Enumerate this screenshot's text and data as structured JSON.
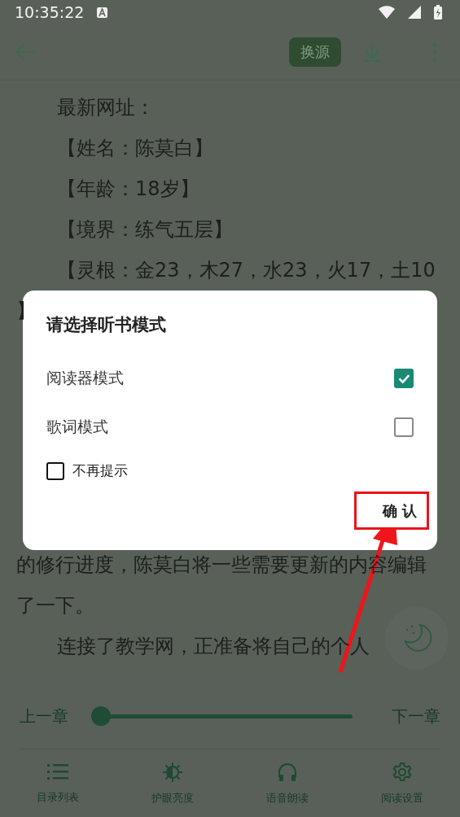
{
  "status_bar": {
    "time": "10:35:22"
  },
  "toolbar": {
    "source_button": "换源"
  },
  "content": {
    "top_lines": [
      {
        "text": "最新网址：",
        "indent": true
      },
      {
        "text": "【姓名：陈莫白】",
        "indent": true
      },
      {
        "text": "【年龄：18岁】",
        "indent": true
      },
      {
        "text": "【境界：练气五层】",
        "indent": true
      },
      {
        "text": "【灵根：金23，木27，水23，火17，土10",
        "indent": true
      },
      {
        "text": "】",
        "indent": false
      }
    ],
    "bottom_lines": [
      {
        "text": "的修行进度，陈莫白将一些需要更新的内容编辑",
        "indent": false
      },
      {
        "text": "了一下。",
        "indent": false
      },
      {
        "text": "连接了教学网，正准备将自己的个人",
        "indent": true
      }
    ]
  },
  "dialog": {
    "title": "请选择听书模式",
    "options": [
      {
        "label": "阅读器模式",
        "checked": true
      },
      {
        "label": "歌词模式",
        "checked": false
      }
    ],
    "dont_show_again": {
      "label": "不再提示",
      "checked": false
    },
    "confirm": "确 认"
  },
  "chapter_bar": {
    "previous": "上一章",
    "next": "下一章",
    "level": 0
  },
  "bottom_nav": [
    {
      "label": "目录列表",
      "kind": "list"
    },
    {
      "label": "护眼亮度",
      "kind": "brightness"
    },
    {
      "label": "语音朗读",
      "kind": "headphones"
    },
    {
      "label": "阅读设置",
      "kind": "settings"
    }
  ]
}
